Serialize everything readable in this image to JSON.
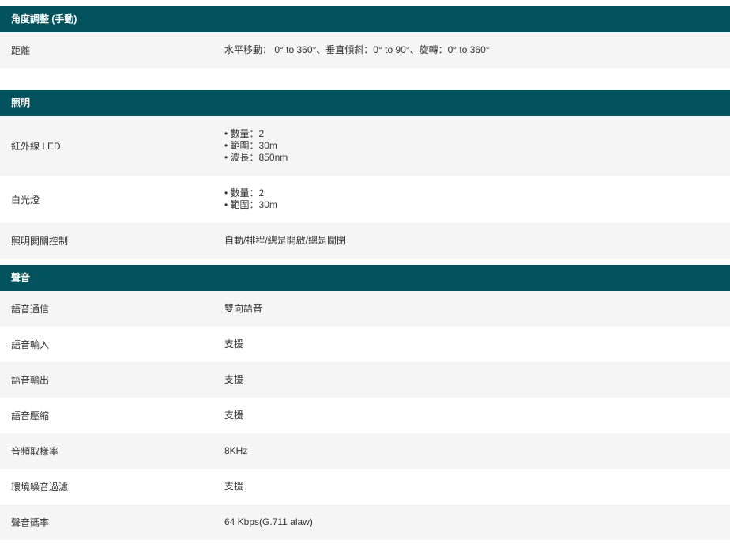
{
  "sections": [
    {
      "title": "角度調整 (手動)",
      "rows": [
        {
          "label": "距離",
          "value": "水平移動： 0° to 360°、垂直傾斜：0° to 90°、旋轉：0° to 360°"
        }
      ]
    },
    {
      "title": "照明",
      "rows": [
        {
          "label": "紅外線 LED",
          "bullets": [
            "數量：2",
            "範圍：30m",
            "波長：850nm"
          ]
        },
        {
          "label": "白光燈",
          "bullets": [
            "數量：2",
            "範圍：30m"
          ]
        },
        {
          "label": "照明開關控制",
          "value": "自動/排程/總是開啟/總是關閉"
        }
      ]
    },
    {
      "title": "聲音",
      "rows": [
        {
          "label": "語音通信",
          "value": "雙向語音"
        },
        {
          "label": "語音輸入",
          "value": "支援"
        },
        {
          "label": "語音輸出",
          "value": "支援"
        },
        {
          "label": "語音壓縮",
          "value": "支援"
        },
        {
          "label": "音頻取樣率",
          "value": "8KHz"
        },
        {
          "label": "環境噪音過濾",
          "value": "支援"
        },
        {
          "label": "聲音碼率",
          "value": "64 Kbps(G.711 alaw)"
        }
      ]
    }
  ]
}
